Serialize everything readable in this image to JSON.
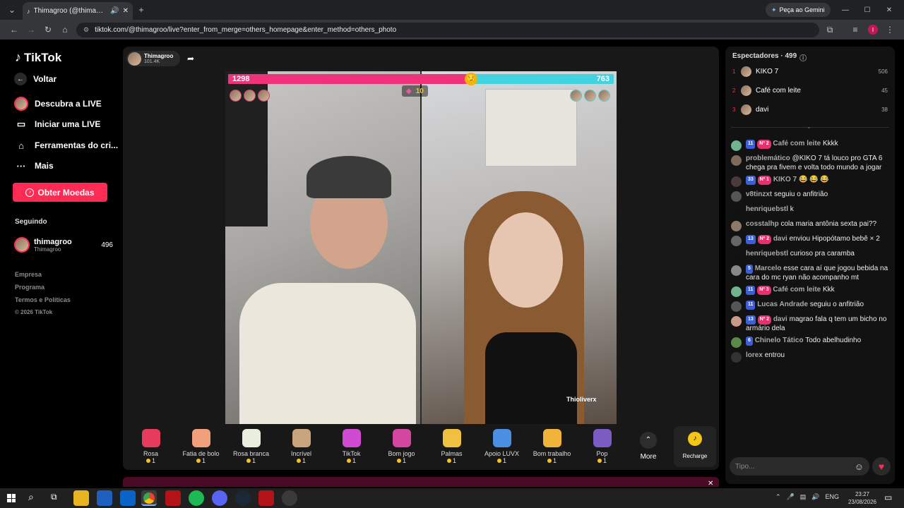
{
  "browser": {
    "tab_title": "Thimagroo (@thimagroo) o",
    "gemini_label": "Peça ao Gemini",
    "url": "tiktok.com/@thimagroo/live?enter_from_merge=others_homepage&enter_method=others_photo",
    "profile_initial": "I"
  },
  "nav": {
    "logo": "TikTok",
    "back": "Voltar",
    "discover_live": "Descubra a LIVE",
    "start_live": "Iniciar uma LIVE",
    "creator_tools": "Ferramentas do cri...",
    "more": "Mais",
    "get_coins": "Obter Moedas",
    "following_header": "Seguindo",
    "following_name": "thimagroo",
    "following_handle": "Thimagroo",
    "following_count": "496",
    "footer_company": "Empresa",
    "footer_program": "Programa",
    "footer_terms": "Termos e Políticas",
    "footer_copy": "© 2026 TikTok"
  },
  "stream": {
    "host_name": "Thimagroo",
    "host_likes": "101.4K",
    "score_left": "1298",
    "score_right": "763",
    "left_fraction": 0.63,
    "timer": "10",
    "right_watermark": "Thioliverx"
  },
  "gifts": [
    {
      "name": "Rosa",
      "price": "1",
      "color": "#e63b5c"
    },
    {
      "name": "Fatia de bolo",
      "price": "1",
      "color": "#f2a07b"
    },
    {
      "name": "Rosa branca",
      "price": "1",
      "color": "#e9eede"
    },
    {
      "name": "Incrível",
      "price": "1",
      "color": "#c9a37c"
    },
    {
      "name": "TikTok",
      "price": "1",
      "color": "#d04bd1"
    },
    {
      "name": "Bom jogo",
      "price": "1",
      "color": "#d4469f"
    },
    {
      "name": "Palmas",
      "price": "1",
      "color": "#f0c140"
    },
    {
      "name": "Apoio LUVX",
      "price": "1",
      "color": "#4b8fe3"
    },
    {
      "name": "Bom trabalho",
      "price": "1",
      "color": "#f0b43a"
    },
    {
      "name": "Pop",
      "price": "1",
      "color": "#7b5cc2"
    }
  ],
  "gift_more": "More",
  "recharge": "Recharge",
  "viewers": {
    "title": "Espectadores · 499",
    "list": [
      {
        "rank": "1",
        "name": "KIKO 7",
        "score": "506"
      },
      {
        "rank": "2",
        "name": "Café com leite",
        "score": "45"
      },
      {
        "rank": "3",
        "name": "davi",
        "score": "38"
      }
    ]
  },
  "chat": [
    {
      "badge": "11",
      "rank": "Nº 2",
      "user": "Café com leite",
      "text": "Kkkk"
    },
    {
      "badge": "",
      "rank": "",
      "user": "problemático",
      "text": "@KIKO 7 tá louco pro GTA 6 chega pra fivem e volta todo mundo a jogar"
    },
    {
      "badge": "33",
      "rank": "Nº 1",
      "user": "KIKO 7",
      "text": "😂 😂 😂"
    },
    {
      "badge": "",
      "rank": "",
      "user": "v8tinzxt",
      "text": "seguiu o anfitrião"
    },
    {
      "badge": "",
      "rank": "",
      "user": "henriquebstl",
      "text": "k"
    },
    {
      "badge": "",
      "rank": "",
      "user": "cosstalhp",
      "text": "cola maria antônia sexta pai??"
    },
    {
      "badge": "13",
      "rank": "Nº 2",
      "user": "davi",
      "text": "enviou Hipopótamo bebê × 2"
    },
    {
      "badge": "",
      "rank": "",
      "user": "henriquebstl",
      "text": "curioso pra caramba"
    },
    {
      "badge": "5",
      "rank": "",
      "user": "Marcelo",
      "text": "esse cara aí que jogou bebida na cara do mc ryan não acompanho mt"
    },
    {
      "badge": "11",
      "rank": "Nº 3",
      "user": "Café com leite",
      "text": "Kkk"
    },
    {
      "badge": "11",
      "rank": "",
      "user": "Lucas Andrade",
      "text": "seguiu o anfitrião"
    },
    {
      "badge": "13",
      "rank": "Nº 2",
      "user": "davi",
      "text": "magrao fala q tem um bicho no armário dela"
    },
    {
      "badge": "6",
      "rank": "",
      "user": "Chinelo Tático",
      "text": "Todo abelhudinho"
    },
    {
      "badge": "",
      "rank": "",
      "user": "lorex",
      "text": "entrou"
    }
  ],
  "chat_input_placeholder": "Tipo...",
  "taskbar": {
    "lang": "ENG",
    "time": "23:27",
    "date": "23/08/2026"
  }
}
